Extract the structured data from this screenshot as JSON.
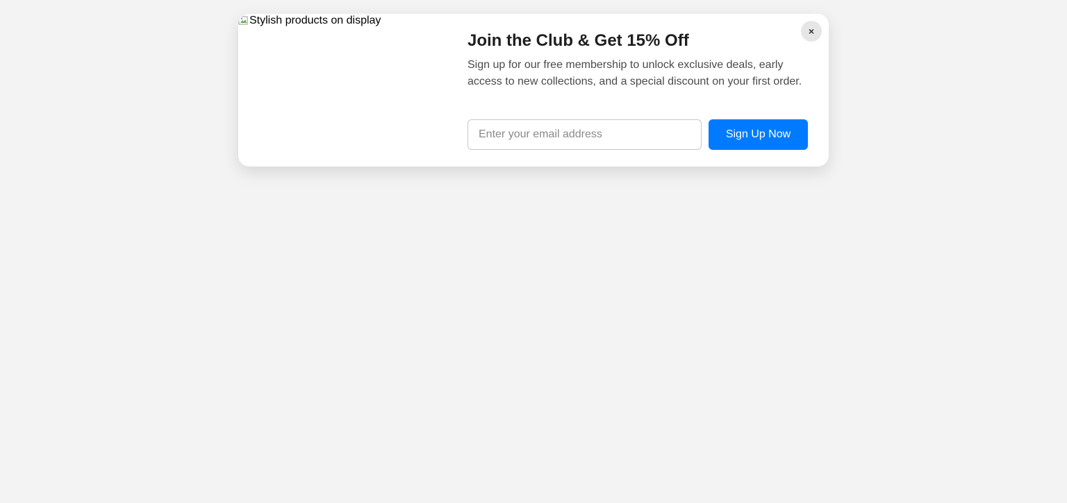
{
  "modal": {
    "image_alt": "Stylish products on display",
    "title": "Join the Club & Get 15% Off",
    "description": "Sign up for our free membership to unlock exclusive deals, early access to new collections, and a special discount on your first order.",
    "email_placeholder": "Enter your email address",
    "email_value": "",
    "signup_label": "Sign Up Now",
    "close_label": "×",
    "close_icon": "close-icon"
  },
  "colors": {
    "background": "#f3f3f3",
    "accent": "#007bff"
  }
}
